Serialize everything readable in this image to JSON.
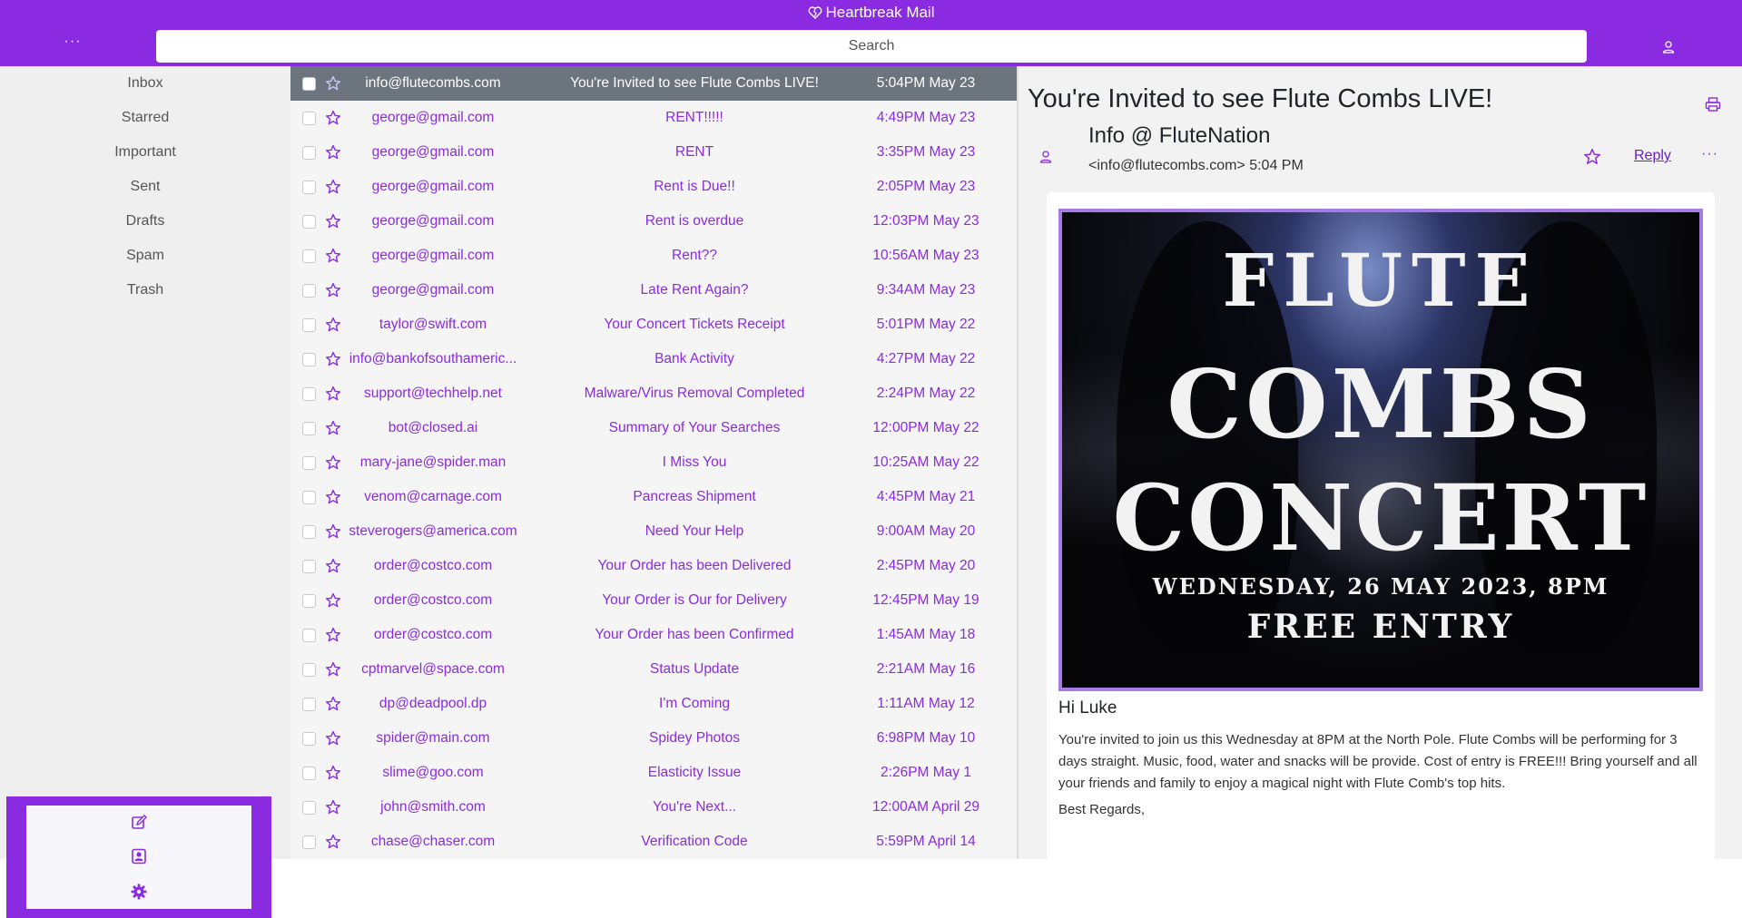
{
  "header": {
    "app_title": "Heartbreak Mail",
    "menu_label": "···",
    "search_placeholder": "Search"
  },
  "sidebar": {
    "items": [
      {
        "label": "Inbox"
      },
      {
        "label": "Starred"
      },
      {
        "label": "Important"
      },
      {
        "label": "Sent"
      },
      {
        "label": "Drafts"
      },
      {
        "label": "Spam"
      },
      {
        "label": "Trash"
      }
    ],
    "tools": [
      "compose-icon",
      "contacts-icon",
      "settings-icon"
    ]
  },
  "emails": [
    {
      "from": "info@flutecombs.com",
      "subject": "You're Invited to see Flute Combs LIVE!",
      "time": "5:04PM May 23",
      "selected": true
    },
    {
      "from": "george@gmail.com",
      "subject": "RENT!!!!!",
      "time": "4:49PM May 23"
    },
    {
      "from": "george@gmail.com",
      "subject": "RENT",
      "time": "3:35PM May 23"
    },
    {
      "from": "george@gmail.com",
      "subject": "Rent is Due!!",
      "time": "2:05PM May 23"
    },
    {
      "from": "george@gmail.com",
      "subject": "Rent is overdue",
      "time": "12:03PM May 23"
    },
    {
      "from": "george@gmail.com",
      "subject": "Rent??",
      "time": "10:56AM May 23"
    },
    {
      "from": "george@gmail.com",
      "subject": "Late Rent Again?",
      "time": "9:34AM May 23"
    },
    {
      "from": "taylor@swift.com",
      "subject": "Your Concert Tickets Receipt",
      "time": "5:01PM May 22"
    },
    {
      "from": "info@bankofsouthameric...",
      "subject": "Bank Activity",
      "time": "4:27PM May 22"
    },
    {
      "from": "support@techhelp.net",
      "subject": "Malware/Virus Removal Completed",
      "time": "2:24PM May 22"
    },
    {
      "from": "bot@closed.ai",
      "subject": "Summary of Your Searches",
      "time": "12:00PM May 22"
    },
    {
      "from": "mary-jane@spider.man",
      "subject": "I Miss You",
      "time": "10:25AM May 22"
    },
    {
      "from": "venom@carnage.com",
      "subject": "Pancreas Shipment",
      "time": "4:45PM May 21"
    },
    {
      "from": "steverogers@america.com",
      "subject": "Need Your Help",
      "time": "9:00AM May 20"
    },
    {
      "from": "order@costco.com",
      "subject": "Your Order has been Delivered",
      "time": "2:45PM May 20"
    },
    {
      "from": "order@costco.com",
      "subject": "Your Order is Our for Delivery",
      "time": "12:45PM May 19"
    },
    {
      "from": "order@costco.com",
      "subject": "Your Order has been Confirmed",
      "time": "1:45AM May 18"
    },
    {
      "from": "cptmarvel@space.com",
      "subject": "Status Update",
      "time": "2:21AM May 16"
    },
    {
      "from": "dp@deadpool.dp",
      "subject": "I'm Coming",
      "time": "1:11AM May 12"
    },
    {
      "from": "spider@main.com",
      "subject": "Spidey Photos",
      "time": "6:98PM May 10"
    },
    {
      "from": "slime@goo.com",
      "subject": "Elasticity Issue",
      "time": "2:26PM May 1"
    },
    {
      "from": "john@smith.com",
      "subject": "You're Next...",
      "time": "12:00AM April 29"
    },
    {
      "from": "chase@chaser.com",
      "subject": "Verification Code",
      "time": "5:59PM April 14"
    }
  ],
  "reader": {
    "subject": "You're Invited to see Flute Combs LIVE!",
    "sender_name": "Info @ FluteNation",
    "sender_meta": "<info@flutecombs.com> 5:04 PM",
    "reply_label": "Reply",
    "more_label": "···",
    "poster": {
      "line1": "FLUTE",
      "line2": "COMBS",
      "line3": "CONCERT",
      "line4": "WEDNESDAY, 26 MAY 2023, 8PM",
      "line5": "FREE ENTRY"
    },
    "greeting": "Hi Luke",
    "paragraph": "You're invited to join us this Wednesday at 8PM at the North Pole. Flute Combs will be performing for 3 days straight. Music, food, water and snacks will be provide. Cost of entry is FREE!!! Bring yourself and all your friends and family to enjoy a magical night with Flute Comb's top hits.",
    "signoff": "Best Regards,"
  },
  "colors": {
    "brand": "#8a2be2",
    "selected_row": "#6c757d",
    "sidebar_bg": "#efefef"
  }
}
